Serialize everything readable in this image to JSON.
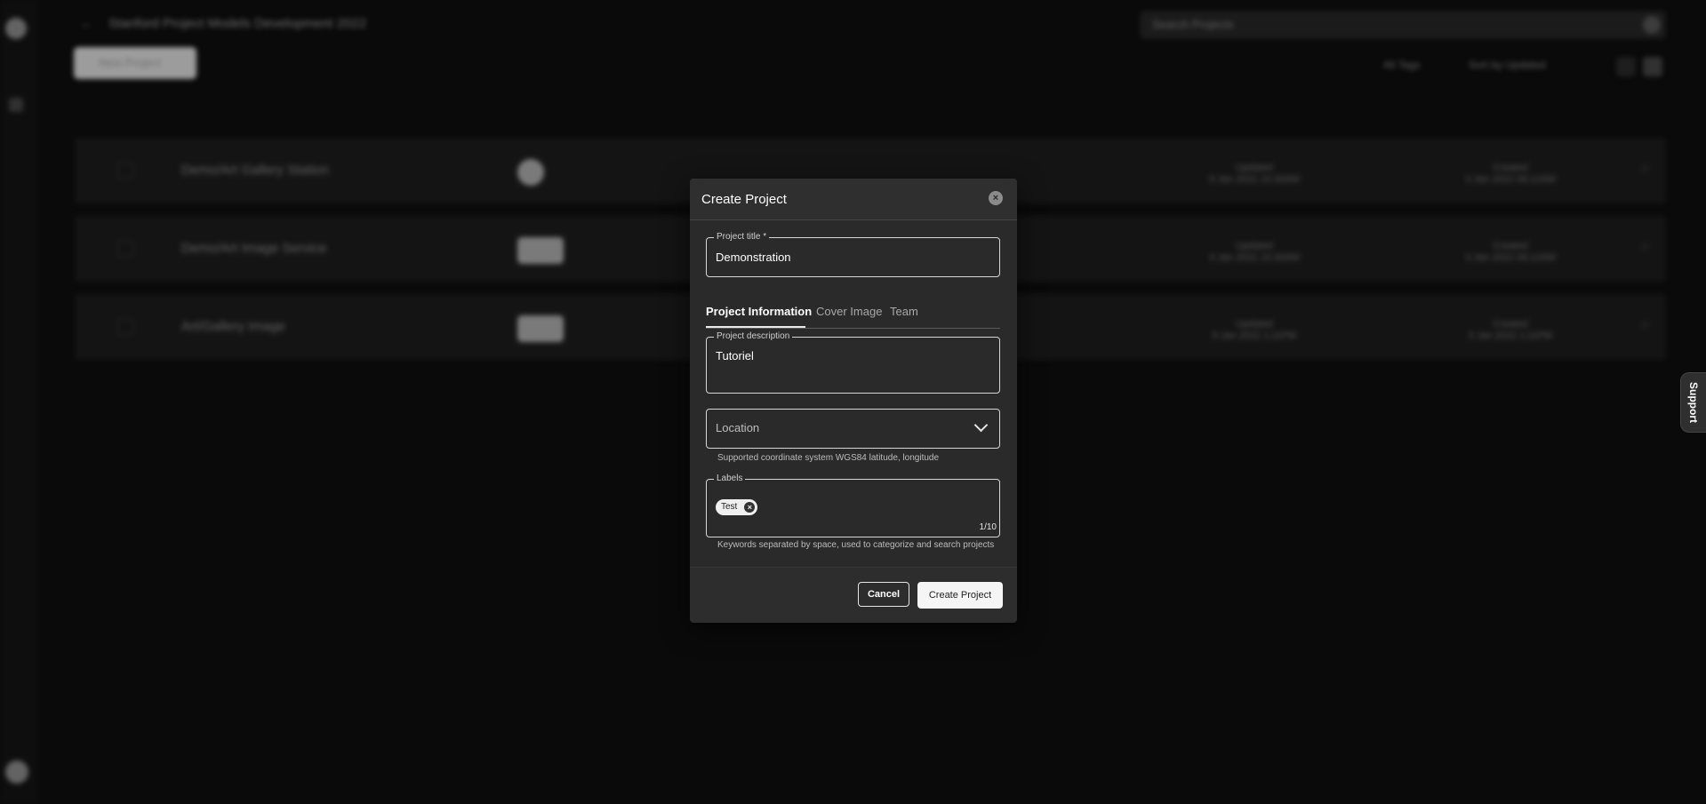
{
  "background": {
    "header_title": "Stanford Project Models Development 2022",
    "search_placeholder": "Search Projects",
    "new_button_label": "New Project",
    "filter_labels": [
      "All Tags",
      "Sort by Updated"
    ],
    "projects": [
      {
        "name": "Demo/Art Gallery Station",
        "created": "Updated\n9 Jan 2022 10:30AM",
        "modified": "Created\n3 Jan 2022 09:12AM"
      },
      {
        "name": "Demo/Art Image Service",
        "created": "Updated\n4 Jan 2022 10:30AM",
        "modified": "Created\n3 Jan 2022 09:12AM"
      },
      {
        "name": "Art/Gallery Image",
        "created": "Updated\n9 Jan 2022 1:11PM",
        "modified": "Created\n3 Jan 2022 1:11PM"
      }
    ]
  },
  "support": {
    "label": "Support"
  },
  "dialog": {
    "title": "Create Project",
    "project_title": {
      "label": "Project title *",
      "value": "Demonstration"
    },
    "tabs": [
      {
        "label": "Project Information",
        "active": true
      },
      {
        "label": "Cover Image",
        "active": false
      },
      {
        "label": "Team",
        "active": false
      }
    ],
    "description": {
      "label": "Project description",
      "value": "Tutoriel"
    },
    "location": {
      "placeholder": "Location",
      "helper": "Supported coordinate system WGS84 latitude, longitude"
    },
    "labels": {
      "label": "Labels",
      "chips": [
        "Test"
      ],
      "counter": "1/10",
      "helper": "Keywords separated by space, used to categorize and search projects"
    },
    "cancel_label": "Cancel",
    "create_label": "Create Project"
  },
  "colors": {
    "background": "#0e0e0e",
    "dialog": "#2a2a2a",
    "primary_button": "#f5f5f5"
  }
}
